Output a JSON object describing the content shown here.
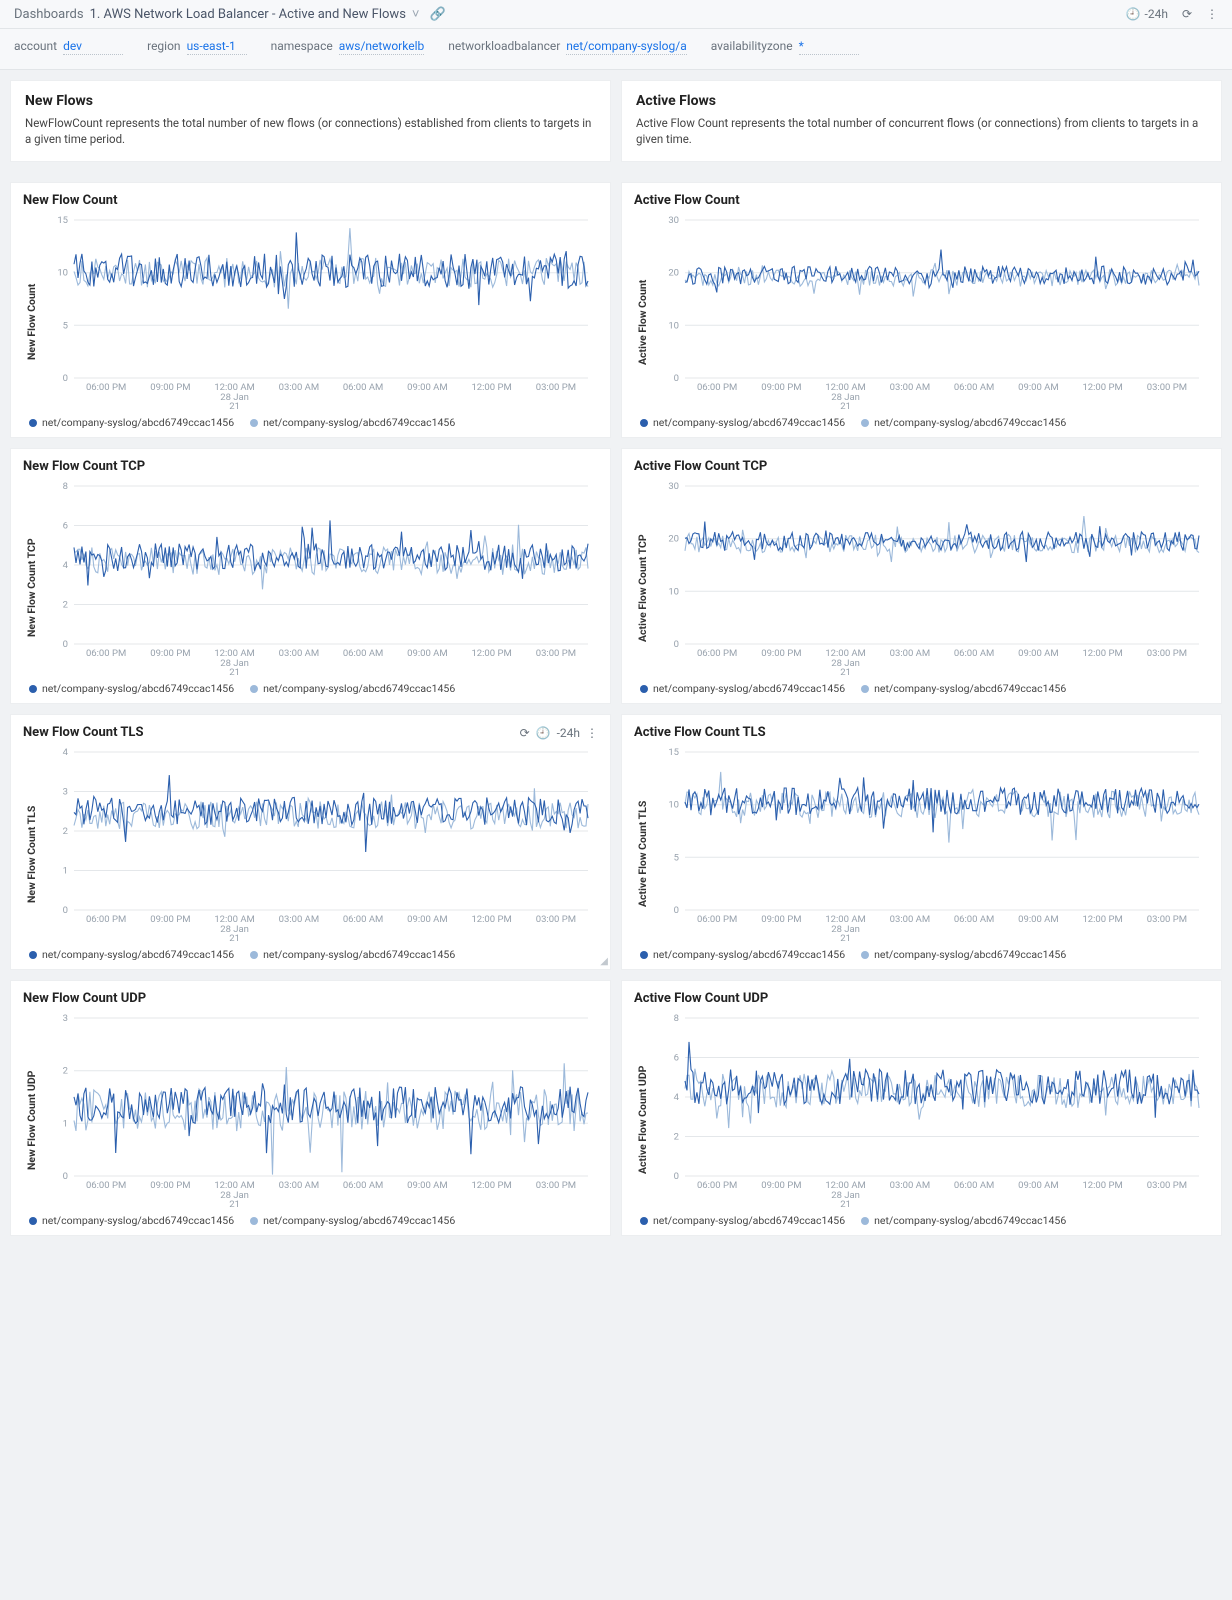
{
  "topbar": {
    "crumb_root": "Dashboards",
    "title": "1. AWS Network Load Balancer - Active and New Flows",
    "time_label": "-24h"
  },
  "filters": {
    "account_label": "account",
    "account_val": "dev",
    "region_label": "region",
    "region_val": "us-east-1",
    "namespace_label": "namespace",
    "namespace_val": "aws/networkelb",
    "nlb_label": "networkloadbalancer",
    "nlb_val": "net/company-syslog/a",
    "az_label": "availabilityzone",
    "az_val": "*"
  },
  "headers": {
    "left_title": "New Flows",
    "left_desc": "NewFlowCount represents the total number of new flows (or connections) established from clients to targets in a given time period.",
    "right_title": "Active Flows",
    "right_desc": "Active Flow Count represents the total number of concurrent flows (or connections) from clients to targets in a given time."
  },
  "legend": {
    "series_a": "net/company-syslog/abcd6749ccac1456",
    "series_b": "net/company-syslog/abcd6749ccac1456"
  },
  "colors": {
    "a": "#2b5fad",
    "b": "#9cb9da"
  },
  "x_ticks": [
    "06:00 PM",
    "09:00 PM",
    "12:00 AM",
    "03:00 AM",
    "06:00 AM",
    "09:00 AM",
    "12:00 PM",
    "03:00 PM"
  ],
  "x_sub_main": "28 Jan",
  "x_sub_year": "21",
  "tls_toolbar_time": "-24h",
  "chart_data": [
    {
      "id": "new_flow_count",
      "title": "New Flow Count",
      "ylabel": "New Flow Count",
      "ymin": 0,
      "ymax": 15,
      "yticks": [
        0,
        5,
        10,
        15
      ],
      "mean_a": 10.2,
      "mean_b": 10.0,
      "noise_a": 1.6,
      "noise_b": 1.4
    },
    {
      "id": "active_flow_count",
      "title": "Active Flow Count",
      "ylabel": "Active Flow Count",
      "ymin": 0,
      "ymax": 30,
      "yticks": [
        0,
        10,
        20,
        30
      ],
      "mean_a": 19.5,
      "mean_b": 19.0,
      "noise_a": 1.8,
      "noise_b": 1.6
    },
    {
      "id": "new_flow_tcp",
      "title": "New Flow Count TCP",
      "ylabel": "New Flow Count TCP",
      "ymin": 0,
      "ymax": 8,
      "yticks": [
        0,
        2,
        4,
        6,
        8
      ],
      "mean_a": 4.4,
      "mean_b": 4.2,
      "noise_a": 0.7,
      "noise_b": 0.7
    },
    {
      "id": "active_flow_tcp",
      "title": "Active Flow Count TCP",
      "ylabel": "Active Flow Count TCP",
      "ymin": 0,
      "ymax": 30,
      "yticks": [
        0,
        10,
        20,
        30
      ],
      "mean_a": 19.5,
      "mean_b": 19.0,
      "noise_a": 1.8,
      "noise_b": 1.7
    },
    {
      "id": "new_flow_tls",
      "title": "New Flow Count TLS",
      "ylabel": "New Flow Count TLS",
      "ymin": 0,
      "ymax": 4,
      "yticks": [
        0,
        1,
        2,
        3,
        4
      ],
      "mean_a": 2.5,
      "mean_b": 2.4,
      "noise_a": 0.35,
      "noise_b": 0.35,
      "tools": true
    },
    {
      "id": "active_flow_tls",
      "title": "Active Flow Count TLS",
      "ylabel": "Active Flow Count TLS",
      "ymin": 0,
      "ymax": 15,
      "yticks": [
        0,
        5,
        10,
        15
      ],
      "mean_a": 10.3,
      "mean_b": 10.0,
      "noise_a": 1.3,
      "noise_b": 1.3
    },
    {
      "id": "new_flow_udp",
      "title": "New Flow Count UDP",
      "ylabel": "New Flow Count UDP",
      "ymin": 0,
      "ymax": 3,
      "yticks": [
        0,
        1,
        2,
        3
      ],
      "mean_a": 1.35,
      "mean_b": 1.25,
      "noise_a": 0.35,
      "noise_b": 0.4
    },
    {
      "id": "active_flow_udp",
      "title": "Active Flow Count UDP",
      "ylabel": "Active Flow Count UDP",
      "ymin": 0,
      "ymax": 8,
      "yticks": [
        0,
        2,
        4,
        6,
        8
      ],
      "mean_a": 4.5,
      "mean_b": 4.3,
      "noise_a": 0.9,
      "noise_b": 0.9
    }
  ]
}
